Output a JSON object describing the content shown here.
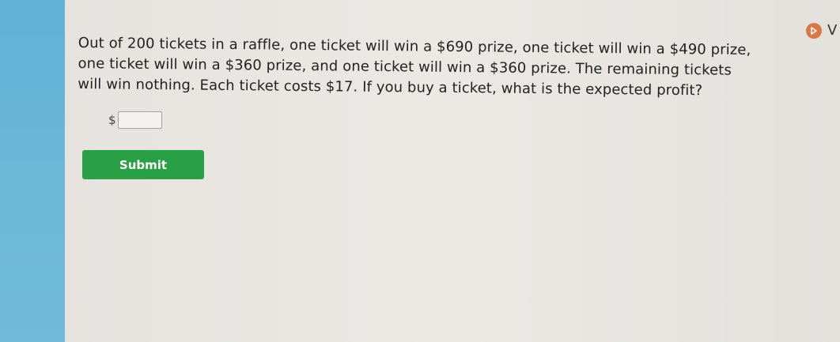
{
  "question": {
    "lines": [
      "Out of 200 tickets in a raffle, one ticket will win a $690 prize, one ticket will win a $490 prize,",
      "one ticket will win a $360 prize, and one ticket will win a $360 prize. The remaining tickets",
      "will win nothing. Each ticket costs $17. If you buy a ticket, what is the expected profit?"
    ]
  },
  "answer": {
    "currency_symbol": "$",
    "value": ""
  },
  "submit": {
    "label": "Submit"
  },
  "video": {
    "icon": "play-icon",
    "label": "V"
  },
  "colors": {
    "submit_bg": "#2aa046",
    "video_icon_bg": "#d97846",
    "left_strip": "#6ab7d8"
  }
}
